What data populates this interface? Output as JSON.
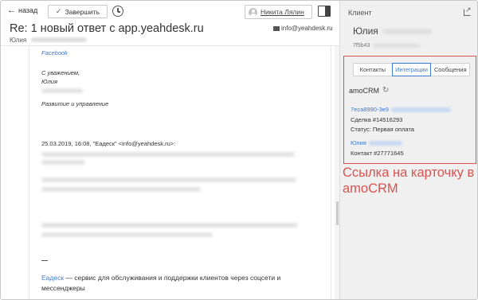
{
  "topbar": {
    "back_label": "назад",
    "finish_label": "Завершить",
    "user_name": "Никита Лялин"
  },
  "ticket": {
    "subject": "Re: 1 новый ответ с app.yeahdesk.ru",
    "reply_to": "info@yeahdesk.ru",
    "from_name": "Юлия"
  },
  "message": {
    "facebook_link": "Facebook",
    "regards": "С уважением,",
    "signature_name": "Юлия",
    "signature_role": "Развитие и управление",
    "quote_header": "25.03.2019, 16:08, \"Еадеск\" <info@yeahdesk.ru>:",
    "footer_brand": "Еадеск",
    "footer_text": " — сервис для обслуживания и поддержки клиентов через соцсети и мессенджеры"
  },
  "sidebar": {
    "title": "Клиент",
    "client_name": "Юлия",
    "client_id": "7f5b43",
    "tabs": [
      {
        "label": "Контакты",
        "active": false
      },
      {
        "label": "Интеграции",
        "active": true
      },
      {
        "label": "Сообщения",
        "active": false
      }
    ],
    "integration": {
      "name": "amoCRM",
      "deal_link": "7eca8990-3e9",
      "deal_number": "Сделка #14516293",
      "deal_status": "Статус: Первая оплата",
      "contact_link": "Юлия",
      "contact_number": "Контакт #27771645"
    }
  },
  "annotation": {
    "text": "Ссылка на карточку в amoCRM",
    "color": "#d9534f"
  },
  "colors": {
    "accent": "#3a7bd5",
    "sidebar_bg": "#f0f0f0"
  },
  "icons": {
    "back": "arrow-left-icon",
    "finish": "check-icon",
    "snooze": "clock-icon",
    "user": "user-avatar-icon",
    "panel": "panel-toggle-icon",
    "mail": "envelope-icon",
    "external": "external-link-icon",
    "refresh": "refresh-icon"
  }
}
